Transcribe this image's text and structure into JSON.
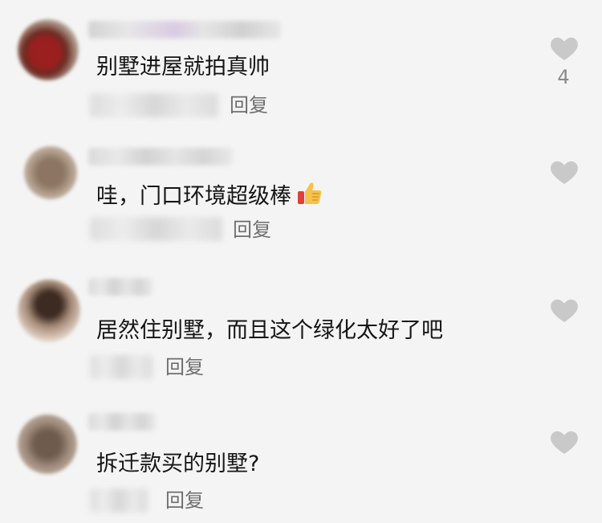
{
  "comments": [
    {
      "text": "别墅进屋就拍真帅",
      "reply_label": "回复",
      "like_icon": "heart-icon",
      "like_count": "4"
    },
    {
      "text": "哇，门口环境超级棒",
      "emoji": "thumbs-up",
      "reply_label": "回复",
      "like_icon": "heart-icon"
    },
    {
      "text": "居然住别墅，而且这个绿化太好了吧",
      "reply_label": "回复",
      "like_icon": "heart-icon"
    },
    {
      "text": "拆迁款买的别墅?",
      "reply_label": "回复",
      "like_icon": "heart-icon"
    }
  ],
  "colors": {
    "background": "#f4f4f4",
    "heart": "#c9c9c9",
    "text": "#151515",
    "reply": "#6e6e6e"
  }
}
